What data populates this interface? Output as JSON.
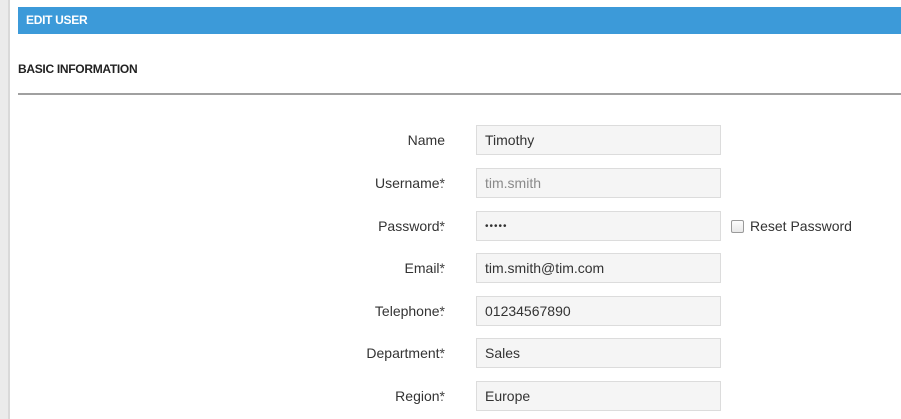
{
  "panel": {
    "title": "EDIT USER"
  },
  "section": {
    "title": "BASIC INFORMATION"
  },
  "form": {
    "colon": ":",
    "fields": [
      {
        "label": "Name",
        "required": "",
        "value": "Timothy",
        "readonly": false
      },
      {
        "label": "Username",
        "required": "*",
        "value": "tim.smith",
        "readonly": true
      },
      {
        "label": "Password",
        "required": "*",
        "value": "•••••",
        "readonly": false
      },
      {
        "label": "Email",
        "required": "*",
        "value": "tim.smith@tim.com",
        "readonly": false
      },
      {
        "label": "Telephone",
        "required": "*",
        "value": "01234567890",
        "readonly": false
      },
      {
        "label": "Department",
        "required": "*",
        "value": "Sales",
        "readonly": false
      },
      {
        "label": "Region",
        "required": "*",
        "value": "Europe",
        "readonly": false
      }
    ],
    "reset_password": {
      "label": "Reset Password",
      "checked": false
    }
  },
  "colors": {
    "header_bg": "#3c9ad9",
    "input_bg": "#f5f5f5",
    "divider": "#a0a0a0"
  }
}
